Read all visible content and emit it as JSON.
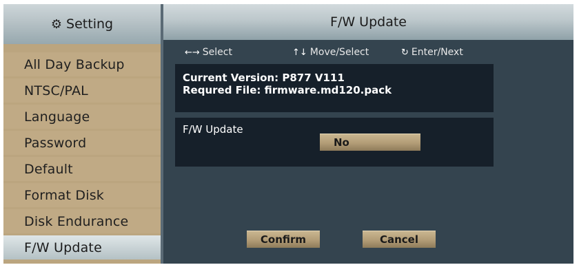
{
  "sidebar": {
    "title": "Setting",
    "title_icon": "gear-icon",
    "items": [
      {
        "label": "All Day Backup"
      },
      {
        "label": "NTSC/PAL"
      },
      {
        "label": "Language"
      },
      {
        "label": "Password"
      },
      {
        "label": "Default"
      },
      {
        "label": "Format Disk"
      },
      {
        "label": "Disk Endurance"
      },
      {
        "label": "F/W Update",
        "active": true
      }
    ]
  },
  "main": {
    "title": "F/W Update",
    "hints": {
      "select": "Select",
      "move_select": "Move/Select",
      "enter_next": "Enter/Next"
    },
    "info": {
      "current_version": "Current Version:  P877  V111",
      "required_file": "Requred File:  firmware.md120.pack"
    },
    "fw_update": {
      "label": "F/W Update",
      "value": "No"
    },
    "buttons": {
      "confirm": "Confirm",
      "cancel": "Cancel"
    }
  },
  "colors": {
    "sidebar_bg": "#bba57f",
    "main_bg": "#34444f",
    "panel_bg": "#16202a",
    "button": "#b29c76"
  }
}
